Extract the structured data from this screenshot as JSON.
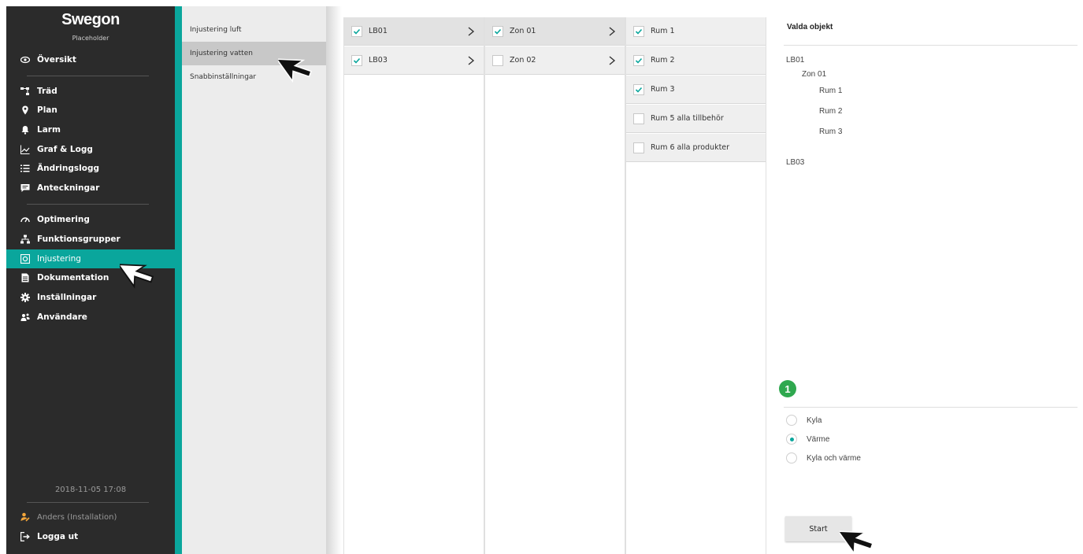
{
  "sidebar": {
    "logo": "Swegon",
    "logo_sub": "Placeholder",
    "items": [
      {
        "label": "Översikt",
        "icon": "eye-icon"
      },
      {
        "label": "Träd",
        "icon": "tree-icon"
      },
      {
        "label": "Plan",
        "icon": "map-pin-icon"
      },
      {
        "label": "Larm",
        "icon": "bell-icon"
      },
      {
        "label": "Graf & Logg",
        "icon": "chart-line-icon"
      },
      {
        "label": "Ändringslogg",
        "icon": "list-icon"
      },
      {
        "label": "Anteckningar",
        "icon": "comment-icon"
      },
      {
        "label": "Optimering",
        "icon": "gauge-icon"
      },
      {
        "label": "Funktionsgrupper",
        "icon": "hierarchy-icon"
      },
      {
        "label": "Injustering",
        "icon": "adjust-icon",
        "active": true
      },
      {
        "label": "Dokumentation",
        "icon": "document-icon"
      },
      {
        "label": "Inställningar",
        "icon": "gear-icon"
      },
      {
        "label": "Användare",
        "icon": "users-icon"
      }
    ],
    "date": "2018-11-05 17:08",
    "user": "Anders (Installation)",
    "logout": "Logga ut"
  },
  "submenu": {
    "items": [
      {
        "label": "Injustering luft"
      },
      {
        "label": "Injustering vatten",
        "active": true
      },
      {
        "label": "Snabbinställningar"
      }
    ]
  },
  "columns": {
    "buildings": [
      {
        "label": "LB01",
        "checked": true
      },
      {
        "label": "LB03",
        "checked": true
      }
    ],
    "zones": [
      {
        "label": "Zon 01",
        "checked": true
      },
      {
        "label": "Zon 02",
        "checked": false
      }
    ],
    "rooms": [
      {
        "label": "Rum 1",
        "checked": true
      },
      {
        "label": "Rum 2",
        "checked": true
      },
      {
        "label": "Rum 3",
        "checked": true
      },
      {
        "label": "Rum 5 alla tillbehör",
        "checked": false
      },
      {
        "label": "Rum 6 alla produkter",
        "checked": false
      }
    ]
  },
  "selected_panel": {
    "title": "Valda objekt",
    "tree": {
      "b1": "LB01",
      "z1": "Zon 01",
      "r1": "Rum 1",
      "r2": "Rum 2",
      "r3": "Rum 3",
      "b2": "LB03"
    },
    "badge": "1",
    "mode_options": [
      {
        "label": "Kyla",
        "selected": false
      },
      {
        "label": "Värme",
        "selected": true
      },
      {
        "label": "Kyla och värme",
        "selected": false
      }
    ],
    "start_label": "Start"
  },
  "colors": {
    "accent": "#0aa69c",
    "sidebar_bg": "#2b2b2b",
    "badge": "#2fa84f"
  }
}
